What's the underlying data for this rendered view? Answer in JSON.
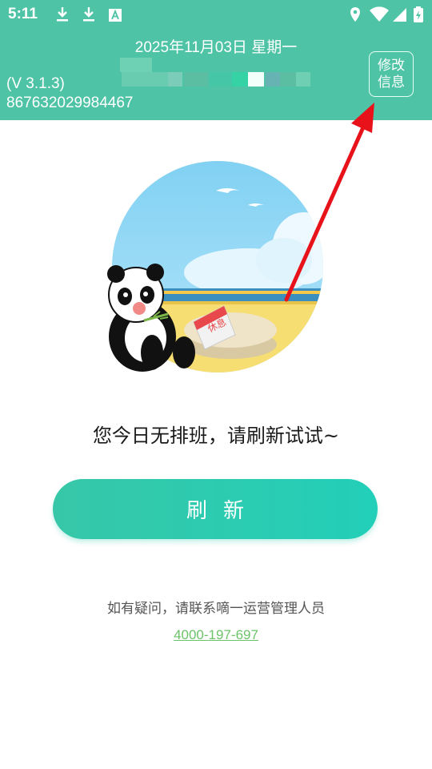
{
  "status_bar": {
    "time": "5:11",
    "icons": [
      "download-icon",
      "download-icon",
      "font-notification-icon",
      "location-icon",
      "wifi-icon",
      "signal-icon",
      "battery-charging-icon"
    ]
  },
  "header": {
    "date": "2025年11月03日  星期一",
    "version": "(V 3.1.3)",
    "device_id": "867632029984467",
    "edit_button": {
      "line1": "修改",
      "line2": "信息"
    },
    "background_color": "#4fc3a5"
  },
  "illustration": {
    "sign_text": "休息"
  },
  "main": {
    "message": "您今日无排班，请刷新试试~",
    "refresh_label": "刷新",
    "contact_text": "如有疑问，请联系嘀一运营管理人员",
    "phone": "4000-197-697"
  },
  "colors": {
    "accent": "#2fcbb0",
    "link": "#6cc36a",
    "arrow": "#e8121b"
  }
}
